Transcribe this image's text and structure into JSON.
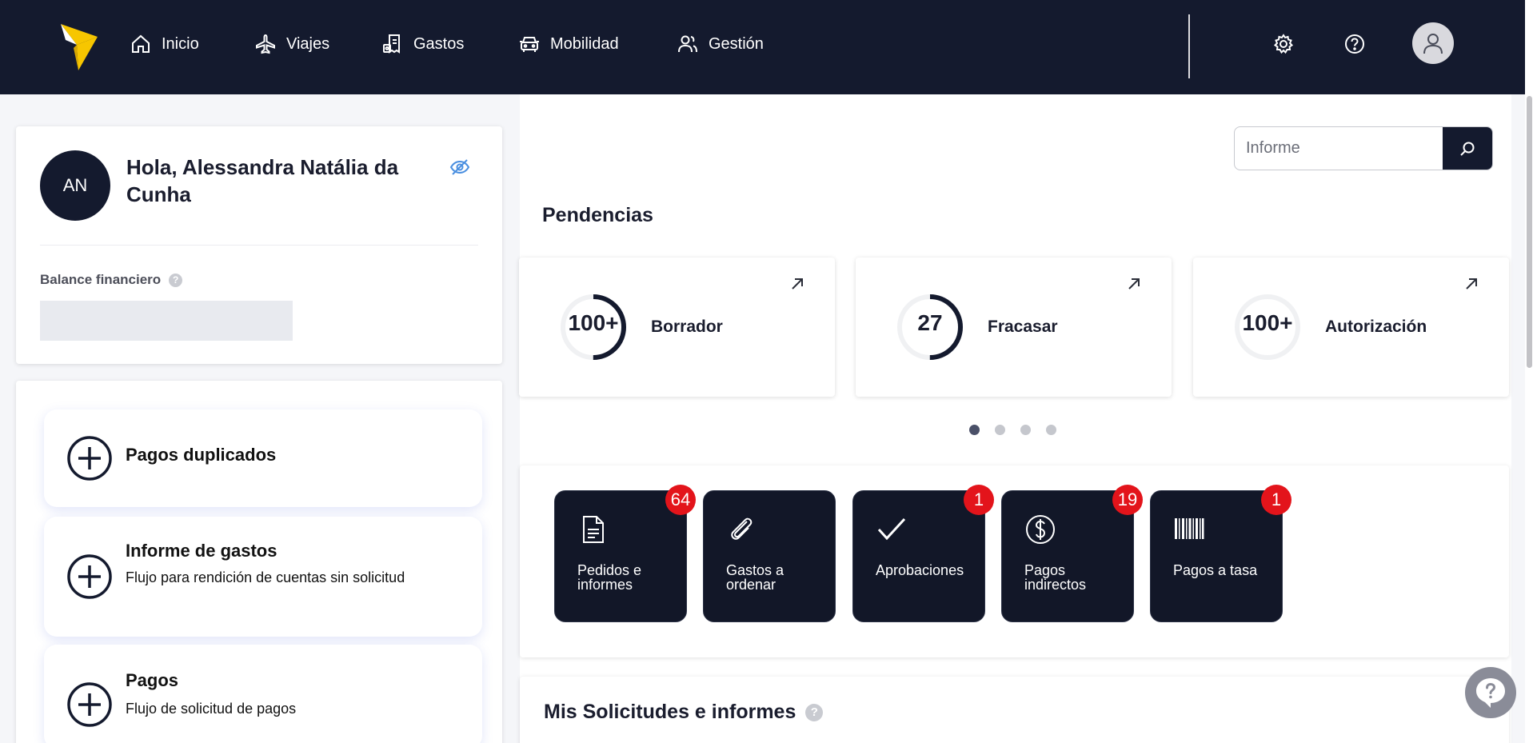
{
  "nav": {
    "items": [
      {
        "label": "Inicio",
        "icon": "home-icon"
      },
      {
        "label": "Viajes",
        "icon": "plane-icon"
      },
      {
        "label": "Gastos",
        "icon": "receipt-icon"
      },
      {
        "label": "Mobilidad",
        "icon": "car-icon"
      },
      {
        "label": "Gestión",
        "icon": "users-icon"
      }
    ],
    "right_icons": [
      "gear-icon",
      "help-icon",
      "user-icon"
    ]
  },
  "profile": {
    "initials": "AN",
    "greeting": "Hola, Alessandra Natália da Cunha",
    "balance_label": "Balance financiero",
    "help_mark": "?"
  },
  "flows": [
    {
      "title": "Pagos duplicados",
      "subtitle": ""
    },
    {
      "title": "Informe de gastos",
      "subtitle": "Flujo para rendición de cuentas sin solicitud"
    },
    {
      "title": "Pagos",
      "subtitle": "Flujo de solicitud de pagos"
    }
  ],
  "search": {
    "placeholder": "Informe"
  },
  "pendencias": {
    "title": "Pendencias",
    "cards": [
      {
        "value": "100+",
        "label": "Borrador",
        "progress": 0.5
      },
      {
        "value": "27",
        "label": "Fracasar",
        "progress": 0.5
      },
      {
        "value": "100+",
        "label": "Autorización",
        "progress": 0
      }
    ],
    "pages": 4,
    "active_page": 0
  },
  "tiles": [
    {
      "label": "Pedidos e informes",
      "badge": "64",
      "icon": "document-icon"
    },
    {
      "label": "Gastos a ordenar",
      "badge": "",
      "icon": "paperclip-icon"
    },
    {
      "label": "Aprobaciones",
      "badge": "1",
      "icon": "check-icon"
    },
    {
      "label": "Pagos indirectos",
      "badge": "19",
      "icon": "dollar-icon"
    },
    {
      "label": "Pagos a tasa",
      "badge": "1",
      "icon": "barcode-icon"
    }
  ],
  "requests": {
    "title": "Mis Solicitudes e informes",
    "help_mark": "?"
  },
  "colors": {
    "navy": "#141a2e",
    "accent_yellow": "#f7c600",
    "badge_red": "#e3141b",
    "link_blue": "#4a8fe0"
  }
}
